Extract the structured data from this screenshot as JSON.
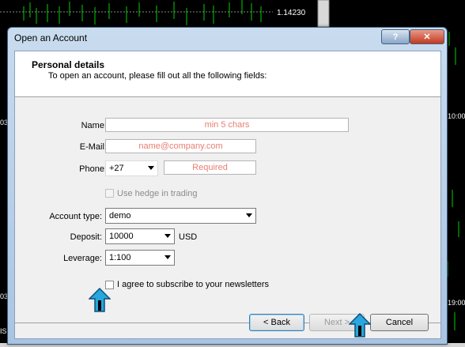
{
  "chart": {
    "price_label": "1.14230",
    "side_labels": [
      "03",
      "10:00",
      "03",
      "19:00",
      "IS"
    ]
  },
  "dialog": {
    "title": "Open an Account",
    "help_label": "?",
    "close_label": "✕",
    "header": {
      "title": "Personal details",
      "subtitle": "To open an account, please fill out all the following fields:"
    },
    "fields": {
      "name": {
        "label": "Name:",
        "placeholder": "min 5 chars"
      },
      "email": {
        "label": "E-Mail:",
        "placeholder": "name@company.com"
      },
      "phone": {
        "label": "Phone:",
        "code": "+27",
        "placeholder": "Required"
      },
      "hedge": {
        "label": "Use hedge in trading"
      },
      "account_type": {
        "label": "Account type:",
        "value": "demo"
      },
      "deposit": {
        "label": "Deposit:",
        "value": "10000",
        "unit": "USD"
      },
      "leverage": {
        "label": "Leverage:",
        "value": "1:100"
      },
      "subscribe": {
        "label": "I agree to subscribe to your newsletters"
      }
    },
    "buttons": {
      "back": "< Back",
      "next": "Next >",
      "cancel": "Cancel"
    }
  },
  "icons": [
    "arrow-up-icon",
    "arrow-up-icon"
  ],
  "colors": {
    "placeholder": "#e87e72",
    "pointer": "#29a6dd",
    "chart_line": "#00e000"
  }
}
